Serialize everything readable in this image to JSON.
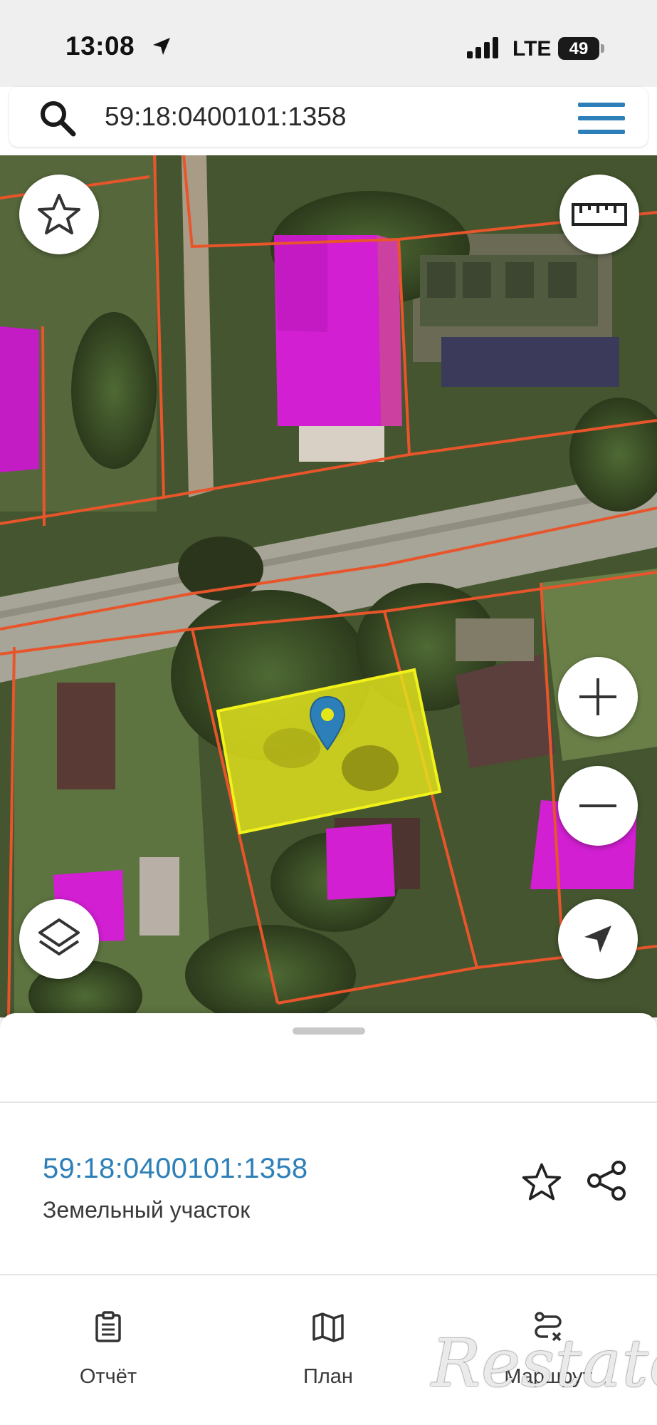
{
  "status_bar": {
    "time": "13:08",
    "network": "LTE",
    "battery": "49"
  },
  "search": {
    "query": "59:18:0400101:1358",
    "icons": {
      "search": "search-icon",
      "menu": "menu-icon"
    }
  },
  "map": {
    "controls": {
      "favorite": "star-icon",
      "ruler": "ruler-icon",
      "zoom_in": "plus-icon",
      "zoom_out": "minus-icon",
      "layers": "layers-icon",
      "locate": "location-arrow-icon"
    },
    "colors": {
      "parcel_border": "#e8552b",
      "selected_parcel_fill": "#e5e51c",
      "selected_parcel_border": "#f2f21a",
      "buildings": "#d21fd2",
      "marker": "#2c7fb8"
    }
  },
  "sheet": {
    "parcel_number": "59:18:0400101:1358",
    "parcel_type": "Земельный участок",
    "icons": {
      "favorite": "star-outline-icon",
      "share": "share-icon"
    }
  },
  "tabs": [
    {
      "label": "Отчёт",
      "icon": "clipboard-icon"
    },
    {
      "label": "План",
      "icon": "map-icon"
    },
    {
      "label": "Маршрут",
      "icon": "route-icon"
    }
  ],
  "watermark": "Restate"
}
